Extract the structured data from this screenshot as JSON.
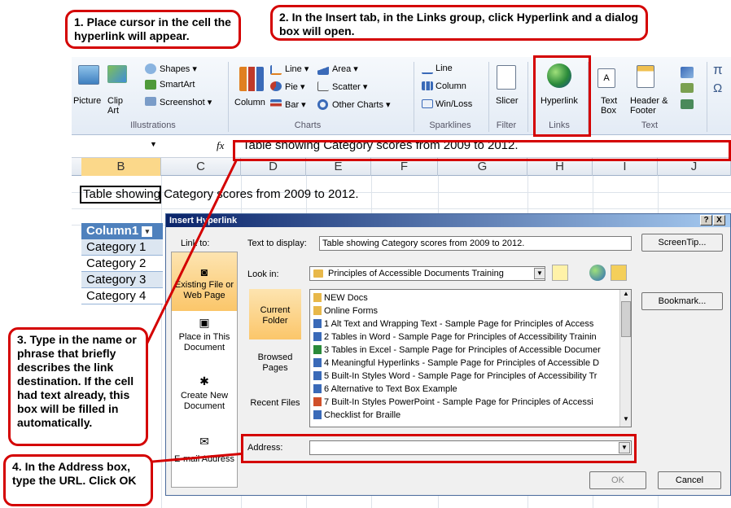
{
  "callouts": {
    "c1": "1. Place cursor in the cell the hyperlink will appear.",
    "c2": "2. In the Insert tab, in the Links group, click Hyperlink and a dialog box will open.",
    "c3": "3. Type in the name or phrase that briefly describes the link destination. If the cell had text already, this box will be filled in automatically.",
    "c4": "4.  In the Address box, type the URL. Click OK"
  },
  "ribbon": {
    "picture": "Picture",
    "clipart": "Clip Art",
    "shapes": "Shapes",
    "smartart": "SmartArt",
    "screenshot": "Screenshot",
    "illustrations": "Illustrations",
    "column": "Column",
    "line": "Line",
    "pie": "Pie",
    "bar": "Bar",
    "area": "Area",
    "scatter": "Scatter",
    "other_charts": "Other Charts",
    "charts": "Charts",
    "sp_line": "Line",
    "sp_column": "Column",
    "sp_winloss": "Win/Loss",
    "sparklines": "Sparklines",
    "slicer": "Slicer",
    "filter": "Filter",
    "hyperlink": "Hyperlink",
    "links": "Links",
    "textbox": "Text Box",
    "header_footer": "Header & Footer",
    "text": "Text",
    "pi": "π",
    "omega": "Ω"
  },
  "formula": {
    "fx": "fx",
    "value": "Table showing Category scores from 2009 to 2012."
  },
  "columns": [
    "B",
    "C",
    "D",
    "E",
    "F",
    "G",
    "H",
    "I",
    "J"
  ],
  "sheet": {
    "b2": "Table showing Category scores from 2009 to 2012.",
    "header": "Column1",
    "rows": [
      "Category 1",
      "Category 2",
      "Category 3",
      "Category 4"
    ]
  },
  "dialog": {
    "title": "Insert Hyperlink",
    "help": "?",
    "close": "X",
    "link_to": "Link to:",
    "text_to_display_label": "Text to display:",
    "text_to_display_value": "Table showing Category scores from 2009 to 2012.",
    "screentip": "ScreenTip...",
    "look_in_label": "Look in:",
    "look_in_value": "Principles of Accessible Documents Training",
    "bookmark": "Bookmark...",
    "nav": [
      "Existing File or Web Page",
      "Place in This Document",
      "Create New Document",
      "E-mail Address"
    ],
    "browse": [
      "Current Folder",
      "Browsed Pages",
      "Recent Files"
    ],
    "files": [
      {
        "name": "NEW Docs",
        "type": "folder"
      },
      {
        "name": "Online Forms",
        "type": "folder"
      },
      {
        "name": "1  Alt Text and Wrapping Text - Sample Page for Principles of Access",
        "type": "word"
      },
      {
        "name": "2  Tables in Word - Sample Page for Principles of Accessibility Trainin",
        "type": "word"
      },
      {
        "name": "3  Tables in Excel - Sample Page for Principles of Accessible Documer",
        "type": "excel"
      },
      {
        "name": "4  Meaningful Hyperlinks - Sample Page for Principles of Accessible D",
        "type": "word"
      },
      {
        "name": "5  Built-In Styles Word - Sample Page for Principles of Accessibility Tr",
        "type": "word"
      },
      {
        "name": "6  Alternative to Text Box Example",
        "type": "word"
      },
      {
        "name": "7  Built-In Styles PowerPoint  -  Sample Page for Principles of Accessi",
        "type": "ppt"
      },
      {
        "name": "Checklist for Braille",
        "type": "word"
      }
    ],
    "address_label": "Address:",
    "address_value": "",
    "ok": "OK",
    "cancel": "Cancel"
  },
  "colors": {
    "callout_border": "#d40000",
    "title_bar": "#0a246a",
    "nav_selected": "#fbd28c"
  }
}
